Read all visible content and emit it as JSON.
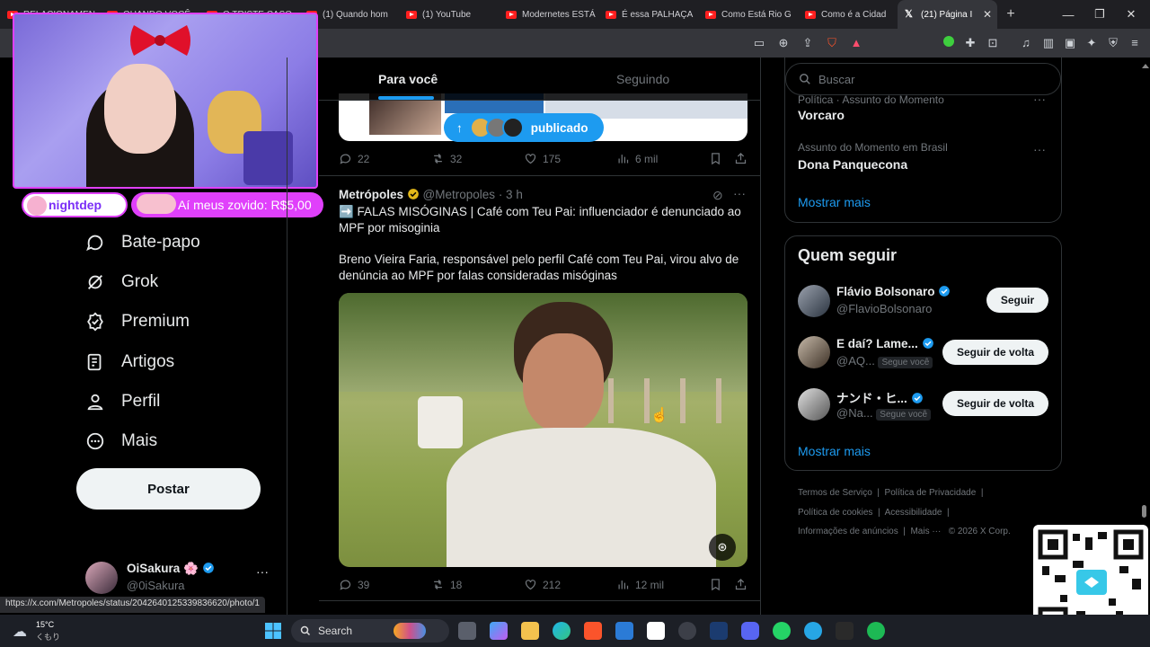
{
  "browser": {
    "tabs": [
      {
        "title": "RELACIONAMEN"
      },
      {
        "title": "QUANDO VOCÊ"
      },
      {
        "title": "O TRISTE CASO"
      },
      {
        "title": "(1) Quando hom"
      },
      {
        "title": "(1) YouTube"
      },
      {
        "title": "Modernetes ESTÁ"
      },
      {
        "title": "É essa PALHAÇA"
      },
      {
        "title": "Como Está Rio G"
      },
      {
        "title": "Como é a Cidad"
      },
      {
        "title": "(21) Página I"
      }
    ],
    "status_url": "https://x.com/Metropoles/status/2042640125339836620/photo/1"
  },
  "stream_overlay": {
    "chat_user": "nightdep",
    "donation": "Aí meus zovido: R$5,00"
  },
  "nav": {
    "items": [
      {
        "label": "Bate-papo",
        "icon": "chat-icon"
      },
      {
        "label": "Grok",
        "icon": "grok-icon"
      },
      {
        "label": "Premium",
        "icon": "premium-icon"
      },
      {
        "label": "Artigos",
        "icon": "articles-icon"
      },
      {
        "label": "Perfil",
        "icon": "profile-icon"
      },
      {
        "label": "Mais",
        "icon": "more-icon"
      }
    ],
    "post_label": "Postar",
    "account": {
      "name": "OiSakura 🌸",
      "handle": "@0iSakura"
    }
  },
  "feed": {
    "tabs": {
      "for_you": "Para você",
      "following": "Seguindo"
    },
    "new_posts_pill": "publicado",
    "tweet1": {
      "replies": "22",
      "retweets": "32",
      "likes": "175",
      "views": "6 mil"
    },
    "tweet2": {
      "author": "Metrópoles",
      "handle": "@Metropoles",
      "time": "· 3 h",
      "text1": "➡️ FALAS MISÓGINAS | Café com Teu Pai: influenciador é denunciado ao MPF por misoginia",
      "text2": "Breno Vieira Faria, responsável pelo perfil Café com Teu Pai, virou alvo de denúncia ao MPF por falas consideradas misóginas",
      "replies": "39",
      "retweets": "18",
      "likes": "212",
      "views": "12 mil"
    }
  },
  "sidebar": {
    "search_placeholder": "Buscar",
    "trends": [
      {
        "context": "Política · Assunto do Momento",
        "name": "Vorcaro"
      },
      {
        "context": "Assunto do Momento em Brasil",
        "name": "Dona Panquecona"
      }
    ],
    "trends_more": "Mostrar mais",
    "who_to_follow": {
      "title": "Quem seguir",
      "people": [
        {
          "name": "Flávio Bolsonaro",
          "handle": "@FlavioBolsonaro",
          "button": "Seguir",
          "follows_you": ""
        },
        {
          "name": "E daí? Lame...",
          "handle": "@AQ...",
          "button": "Seguir de volta",
          "follows_you": "Segue você"
        },
        {
          "name": "ナンド・ヒ...",
          "handle": "@Na...",
          "button": "Seguir de volta",
          "follows_you": "Segue você"
        }
      ],
      "more": "Mostrar mais"
    },
    "footer": {
      "l1a": "Termos de Serviço",
      "l1b": "Política de Privacidade",
      "l2a": "Política de cookies",
      "l2b": "Acessibilidade",
      "l3a": "Informações de anúncios",
      "l3b": "Mais ···",
      "l3c": "© 2026 X Corp."
    }
  },
  "taskbar": {
    "weather_temp": "15°C",
    "weather_desc": "くもり",
    "search": "Search"
  },
  "colors": {
    "accent": "#1d9bf0",
    "background": "#000000",
    "border": "#2f3336"
  }
}
